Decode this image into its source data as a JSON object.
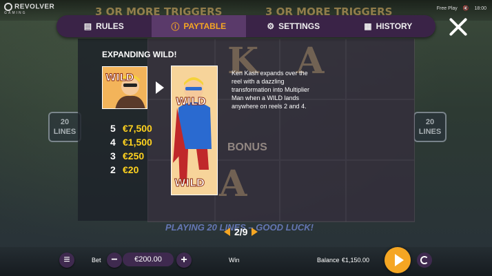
{
  "brand": {
    "name": "REVOLVER",
    "sub": "GAMING"
  },
  "banner": {
    "left": "3 OR MORE TRIGGERS",
    "right": "3 OR MORE TRIGGERS"
  },
  "status": {
    "mode": "Free Play",
    "time": "18:00"
  },
  "side_lines": {
    "number": "20",
    "word": "LINES"
  },
  "tabs": [
    {
      "label": "RULES",
      "icon": "book-icon",
      "active": false
    },
    {
      "label": "PAYTABLE",
      "icon": "info-icon",
      "active": true
    },
    {
      "label": "SETTINGS",
      "icon": "gear-icon",
      "active": false
    },
    {
      "label": "HISTORY",
      "icon": "calendar-icon",
      "active": false
    }
  ],
  "paytable": {
    "title": "EXPANDING WILD!",
    "symbol_label": "WILD",
    "description": "Ken Kash expands over the reel with a dazzling transformation into Multiplier Man when a WILD lands anywhere on reels 2 and 4.",
    "payouts": [
      {
        "count": "5",
        "value": "€7,500"
      },
      {
        "count": "4",
        "value": "€1,500"
      },
      {
        "count": "3",
        "value": "€250"
      },
      {
        "count": "2",
        "value": "€20"
      }
    ],
    "page": "2/9"
  },
  "background": {
    "playing_text": "PLAYING 20 LINES – GOOD LUCK!",
    "bonus_text": "BONUS"
  },
  "controls": {
    "bet_label": "Bet",
    "bet_value": "€200.00",
    "win_label": "Win",
    "balance_label": "Balance",
    "balance_value": "€1,150.00"
  },
  "colors": {
    "accent": "#f5a623",
    "payout": "#ffd21f",
    "tab_bg": "#3a2347",
    "tab_active": "#5a3a6a"
  }
}
